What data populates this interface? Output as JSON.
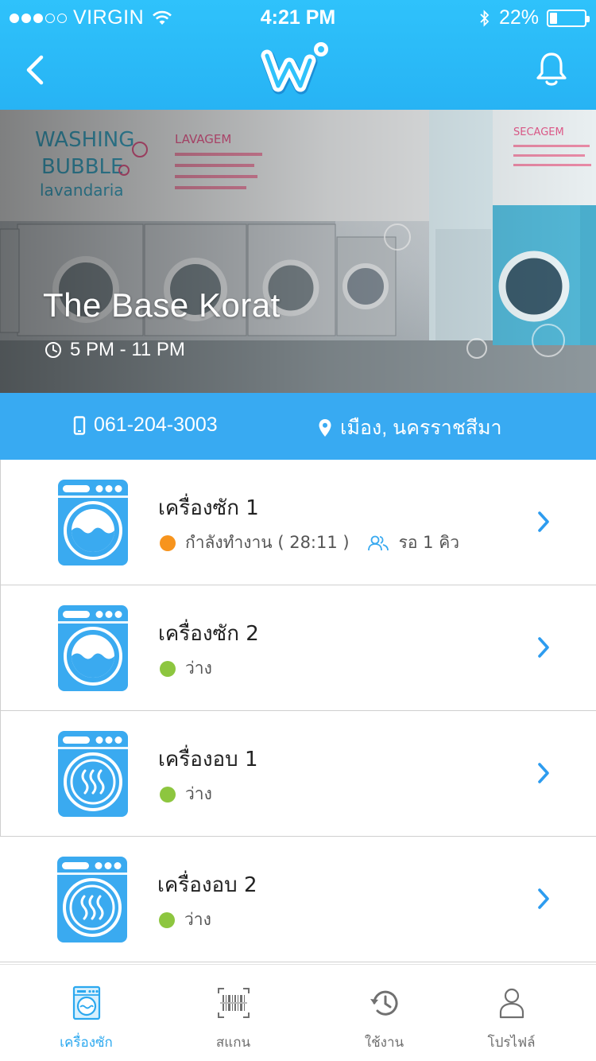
{
  "status_bar": {
    "carrier": "VIRGIN",
    "time": "4:21 PM",
    "battery": "22%",
    "battery_level": 0.22,
    "signal_bars": 3,
    "signal_total": 5
  },
  "header": {
    "logo_text": "W",
    "back_icon": "chevron-left-icon",
    "notification_icon": "bell-icon"
  },
  "shop": {
    "name": "The Base Korat",
    "hours": "5 PM - 11 PM",
    "phone": "061-204-3003",
    "location": "เมือง, นครราชสีมา"
  },
  "machines": [
    {
      "name": "เครื่องซัก 1",
      "status": "กำลังทำงาน ( 28:11 )",
      "status_color": "#f7941d",
      "queue": "รอ 1 คิว",
      "kind": "washer"
    },
    {
      "name": "เครื่องซัก 2",
      "status": "ว่าง",
      "status_color": "#8dc63f",
      "queue": "",
      "kind": "washer"
    },
    {
      "name": "เครื่องอบ 1",
      "status": "ว่าง",
      "status_color": "#8dc63f",
      "queue": "",
      "kind": "dryer"
    },
    {
      "name": "เครื่องอบ 2",
      "status": "ว่าง",
      "status_color": "#8dc63f",
      "queue": "",
      "kind": "dryer"
    }
  ],
  "tabs": [
    {
      "label": "เครื่องซัก",
      "icon": "washer-icon",
      "active": true
    },
    {
      "label": "สแกน",
      "icon": "barcode-scan-icon",
      "active": false
    },
    {
      "label": "ใช้งาน",
      "icon": "history-icon",
      "active": false
    },
    {
      "label": "โปรไฟล์",
      "icon": "profile-icon",
      "active": false
    }
  ],
  "colors": {
    "brand_blue": "#2fb6f7",
    "info_bar": "#38aaf2",
    "busy": "#f7941d",
    "available": "#8dc63f",
    "active_tab": "#2ba8ef"
  }
}
